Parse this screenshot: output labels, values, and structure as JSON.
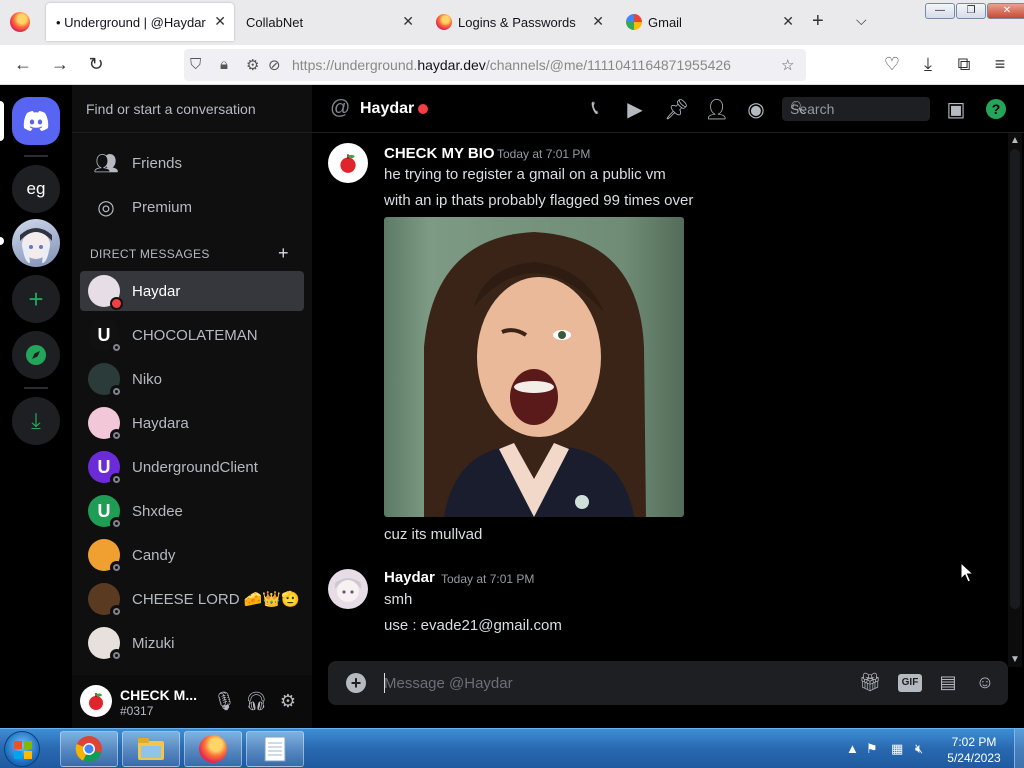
{
  "browser": {
    "tabs": [
      {
        "label": "• Underground | @Haydar",
        "active": true
      },
      {
        "label": "CollabNet",
        "active": false
      },
      {
        "label": "Logins & Passwords",
        "active": false
      },
      {
        "label": "Gmail",
        "active": false
      }
    ],
    "url_prefix": "https://underground.",
    "url_domain": "haydar.dev",
    "url_path": "/channels/@me/1111041164871955426"
  },
  "guilds": [
    {
      "label": "eg"
    }
  ],
  "dms": {
    "search_placeholder": "Find or start a conversation",
    "nav": [
      {
        "label": "Friends",
        "icon": "friends-icon"
      },
      {
        "label": "Premium",
        "icon": "nitro-icon"
      }
    ],
    "header": "DIRECT MESSAGES",
    "conversations": [
      {
        "name": "Haydar",
        "status": "dnd",
        "selected": true,
        "avatar_color": "#e6dde6",
        "avatar_letter": ""
      },
      {
        "name": "CHOCOLATEMAN",
        "status": "offline",
        "selected": false,
        "avatar_color": "#111111",
        "avatar_letter": "U"
      },
      {
        "name": "Niko",
        "status": "offline",
        "selected": false,
        "avatar_color": "#2a3b3a",
        "avatar_letter": ""
      },
      {
        "name": "Haydara",
        "status": "offline",
        "selected": false,
        "avatar_color": "#f2c7d8",
        "avatar_letter": ""
      },
      {
        "name": "UndergroundClient",
        "status": "offline",
        "selected": false,
        "avatar_color": "#6c2bd9",
        "avatar_letter": "U"
      },
      {
        "name": "Shxdee",
        "status": "offline",
        "selected": false,
        "avatar_color": "#1f9d55",
        "avatar_letter": "U"
      },
      {
        "name": "Candy",
        "status": "offline",
        "selected": false,
        "avatar_color": "#f0a030",
        "avatar_letter": ""
      },
      {
        "name": "CHEESE LORD 🧀👑🫡",
        "status": "offline",
        "selected": false,
        "avatar_color": "#5a3b22",
        "avatar_letter": ""
      },
      {
        "name": "Mizuki",
        "status": "offline",
        "selected": false,
        "avatar_color": "#e8e0dc",
        "avatar_letter": ""
      }
    ]
  },
  "user_panel": {
    "name": "CHECK M...",
    "tag": "#0317"
  },
  "chat": {
    "recipient": "Haydar",
    "search_placeholder": "Search",
    "composer_placeholder": "Message @Haydar",
    "messages": [
      {
        "author": "CHECK MY BIO",
        "time": "Today at 7:01 PM",
        "lines": [
          "he trying to register a gmail on a public vm",
          "with an ip thats probably flagged 99 times over"
        ],
        "after_image": "cuz its mullvad"
      },
      {
        "author": "Haydar",
        "time": "Today at 7:01 PM",
        "lines": [
          "smh",
          "use : evade21@gmail.com"
        ]
      }
    ]
  },
  "taskbar": {
    "time": "7:02 PM",
    "date": "5/24/2023"
  },
  "colors": {
    "blurple": "#5865f2",
    "dnd_red": "#f23f43",
    "online_green": "#23a55a"
  }
}
